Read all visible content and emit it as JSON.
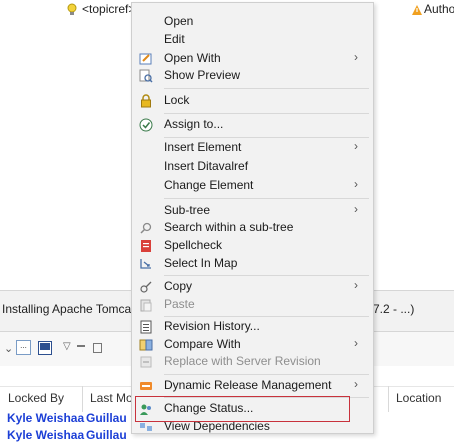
{
  "editor": {
    "topicref_text": "<topicref> TEST for Tomcat",
    "author_text": "Autho"
  },
  "views": {
    "tab_label": "Installing Apache Tomcat",
    "tab_right": "7.2 - ...)",
    "more_button": "..."
  },
  "table": {
    "headers": [
      "Locked By",
      "Last Mo",
      "Location"
    ],
    "rows": [
      [
        "Kyle Weishaa",
        "Guillaur"
      ],
      [
        "Kyle Weishaa",
        "Guillaur"
      ]
    ]
  },
  "menu": {
    "items": [
      {
        "label": "Open",
        "icon": "",
        "submenu": false
      },
      {
        "label": "Edit",
        "icon": "",
        "submenu": false
      },
      {
        "label": "Open With",
        "icon": "open-with-icon",
        "submenu": true
      },
      {
        "label": "Show Preview",
        "icon": "preview-icon",
        "submenu": false
      },
      {
        "label": "Lock",
        "icon": "lock-icon",
        "submenu": false
      },
      {
        "label": "Assign to...",
        "icon": "assign-icon",
        "submenu": false
      },
      {
        "label": "Insert Element",
        "icon": "",
        "submenu": true
      },
      {
        "label": "Insert Ditavalref",
        "icon": "",
        "submenu": false
      },
      {
        "label": "Change Element",
        "icon": "",
        "submenu": true
      },
      {
        "label": "Sub-tree",
        "icon": "",
        "submenu": true
      },
      {
        "label": "Search within a sub-tree",
        "icon": "search-icon",
        "submenu": false
      },
      {
        "label": "Spellcheck",
        "icon": "spellcheck-icon",
        "submenu": false
      },
      {
        "label": "Select In Map",
        "icon": "select-in-map-icon",
        "submenu": false
      },
      {
        "label": "Copy",
        "icon": "copy-icon",
        "submenu": true
      },
      {
        "label": "Paste",
        "icon": "paste-icon",
        "submenu": false,
        "disabled": true
      },
      {
        "label": "Revision History...",
        "icon": "revision-history-icon",
        "submenu": false
      },
      {
        "label": "Compare With",
        "icon": "compare-icon",
        "submenu": true
      },
      {
        "label": "Replace with Server Revision",
        "icon": "replace-icon",
        "submenu": false,
        "disabled": true
      },
      {
        "label": "Dynamic Release Management",
        "icon": "drm-icon",
        "submenu": true
      },
      {
        "label": "Change Status...",
        "icon": "change-status-icon",
        "submenu": false
      },
      {
        "label": "View Dependencies",
        "icon": "dependencies-icon",
        "submenu": false
      }
    ],
    "submenu_arrow": "›",
    "colors": {
      "highlight_border": "#c8323c",
      "menu_bg": "#f2f2f2"
    }
  }
}
